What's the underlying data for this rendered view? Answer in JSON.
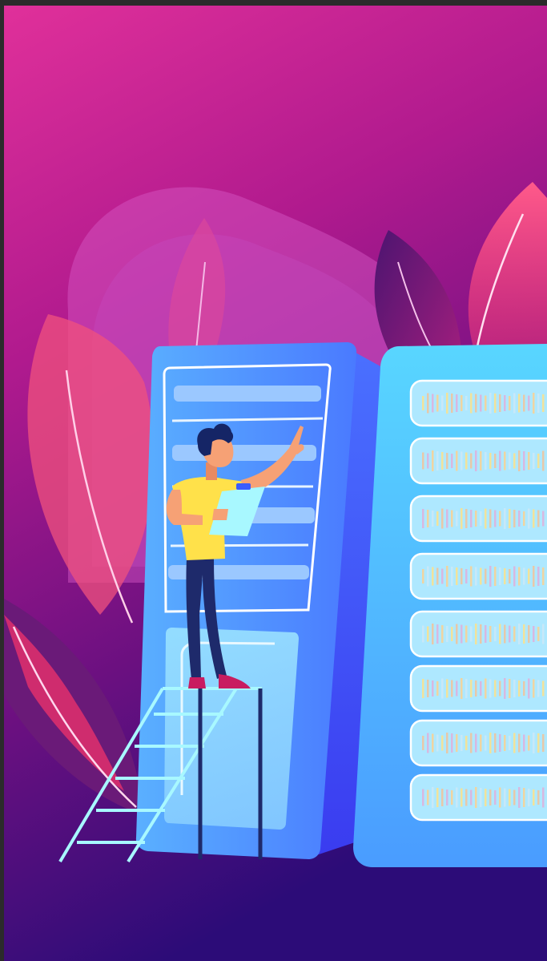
{
  "illustration": {
    "subject": "person-on-ladder-with-clipboard-at-server-racks",
    "palette": {
      "bg_top": "#e0309a",
      "bg_mid": "#a3168a",
      "bg_bottom": "#2c0c78",
      "server_light": "#5ad8ff",
      "server_dark": "#3a5cff",
      "shirt": "#ffe14a",
      "pants": "#1e2a6b",
      "shoes": "#c81c60",
      "skin": "#f6a175",
      "hair": "#152566",
      "ladder": "#a8f8ff"
    },
    "right_rack_slots": 8,
    "left_rack_lines": 6
  }
}
